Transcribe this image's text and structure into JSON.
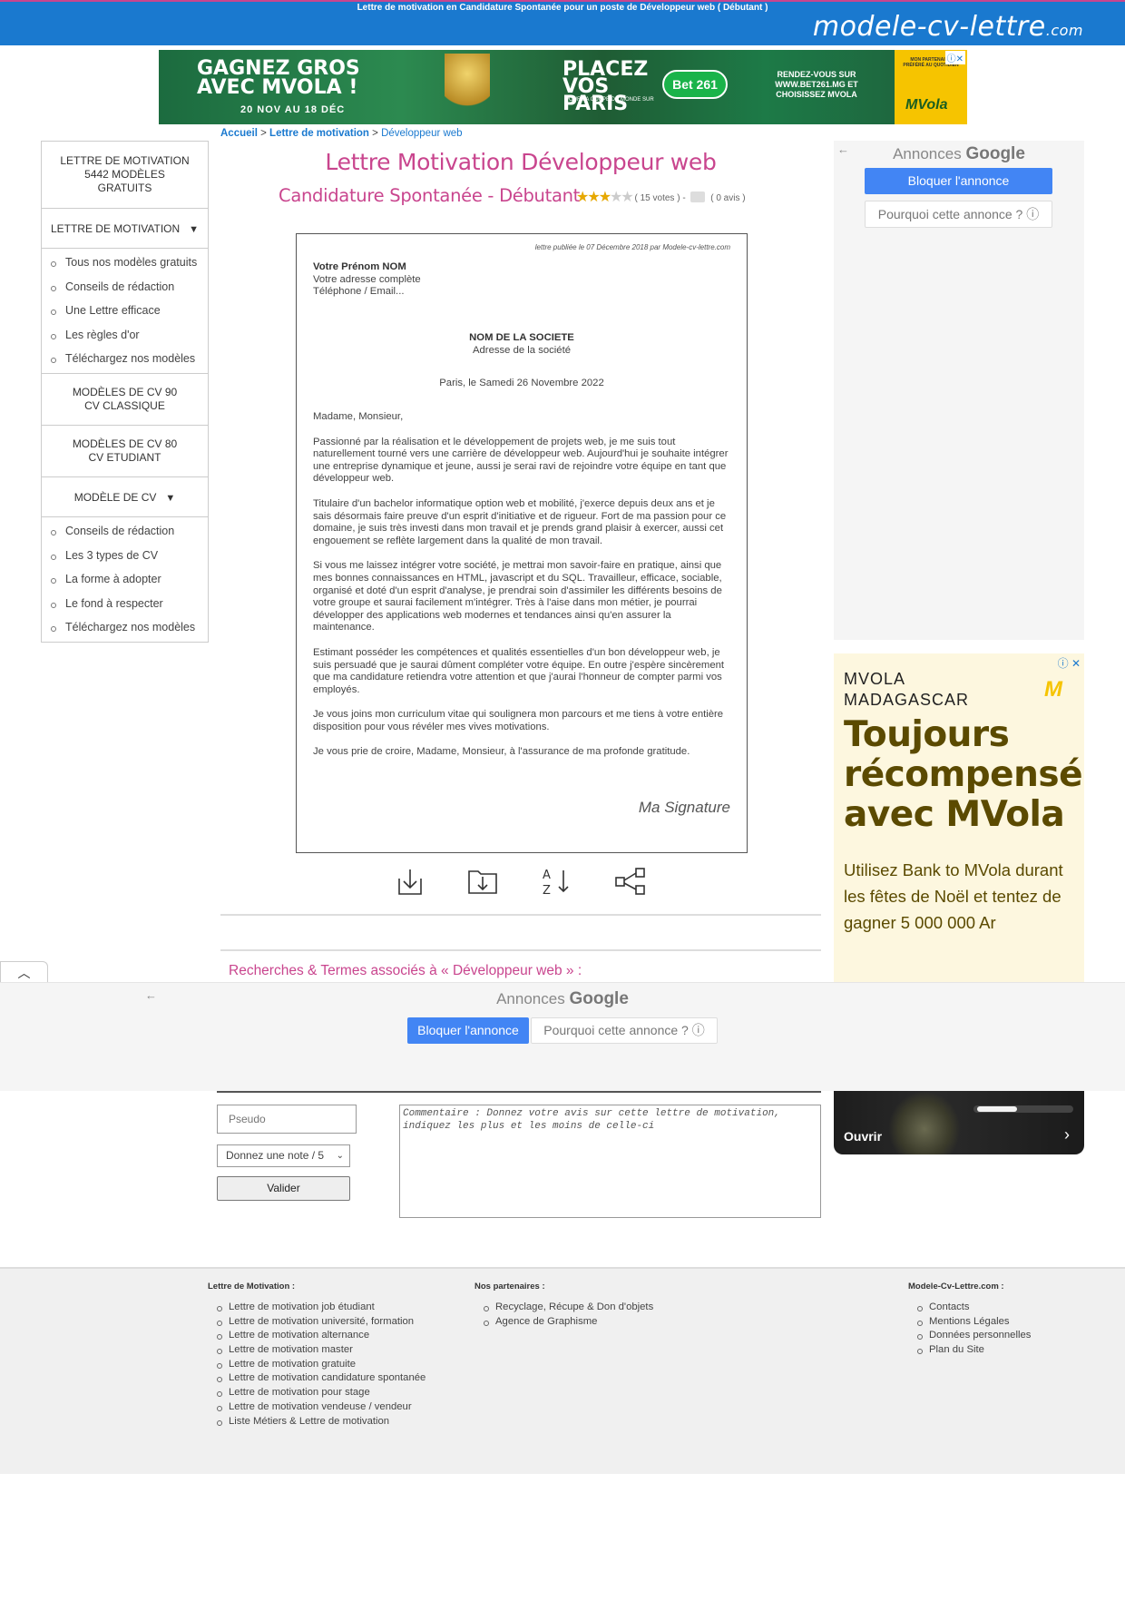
{
  "header": {
    "tagline": "Lettre de motivation en Candidature Spontanée pour un poste de Développeur web ( Débutant )",
    "logo_main": "modele-cv-lettre",
    "logo_tld": ".com",
    "brand_color": "#1a79cf",
    "accent_color": "#c9458e"
  },
  "banner_ad": {
    "headline": "GAGNEZ GROS AVEC MVOLA !",
    "dates": "20 NOV AU 18 DÉC",
    "place": "PLACEZ VOS PARIS",
    "place_sub": "POUR LA COUPE DU MONDE SUR",
    "bet_logo": "Bet 261",
    "cta": "RENDEZ-VOUS SUR WWW.BET261.MG ET CHOISISSEZ MVOLA",
    "partner": "MON PARTENAIRE PRÉFÉRÉ AU QUOTIDIEN",
    "mvola": "MVola"
  },
  "sidebar": {
    "block1": "LETTRE DE MOTIVATION 5442 MODÈLES GRATUITS",
    "section1": "LETTRE DE MOTIVATION",
    "section1_items": [
      "Tous nos modèles gratuits",
      "Conseils de rédaction",
      "Une Lettre efficace",
      "Les règles d'or",
      "Téléchargez nos modèles"
    ],
    "block2": "MODÈLES DE CV 90 CV CLASSIQUE",
    "block3": "MODÈLES DE CV 80 CV ETUDIANT",
    "section2": "MODÈLE DE CV",
    "section2_items": [
      "Conseils de rédaction",
      "Les 3 types de CV",
      "La forme à adopter",
      "Le fond à respecter",
      "Téléchargez nos modèles"
    ],
    "arrow": "▼"
  },
  "breadcrumb": {
    "home": "Accueil",
    "sep": ">",
    "section": "Lettre de motivation",
    "current": "Développeur web"
  },
  "page": {
    "title": "Lettre Motivation Développeur web",
    "subtitle": "Candidature Spontanée - Débutant",
    "rating_stars": 3,
    "votes": "( 15 votes )",
    "dash": "-",
    "avis": "( 0 avis )"
  },
  "letter": {
    "published": "lettre publiée le 07 Décembre 2018 par Modele-cv-lettre.com",
    "sender_name": "Votre Prénom NOM",
    "sender_address": "Votre adresse complète",
    "sender_contact": "Téléphone / Email...",
    "company_name": "NOM DE LA SOCIETE",
    "company_address": "Adresse de la société",
    "date": "Paris, le Samedi 26 Novembre 2022",
    "greeting": "Madame, Monsieur,",
    "paragraphs": [
      "Passionné par la réalisation et le développement de projets web, je me suis tout naturellement tourné vers une carrière de développeur web. Aujourd'hui je souhaite intégrer une entreprise dynamique et jeune, aussi je serai ravi de rejoindre votre équipe en tant que développeur web.",
      "Titulaire d'un bachelor informatique option web et mobilité, j'exerce depuis deux ans et je sais désormais faire preuve d'un esprit d'initiative et de rigueur. Fort de ma passion pour ce domaine, je suis très investi dans mon travail et je prends grand plaisir à exercer, aussi cet engouement se reflète largement dans la qualité de mon travail.",
      "Si vous me laissez intégrer votre société, je mettrai mon savoir-faire en pratique, ainsi que mes bonnes connaissances en HTML, javascript et du SQL. Travailleur, efficace, sociable, organisé et doté d'un esprit d'analyse, je prendrai soin d'assimiler les différents besoins de votre groupe et saurai facilement m'intégrer. Très à l'aise dans mon métier, je pourrai développer des applications web modernes et tendances ainsi qu'en assurer la maintenance.",
      "Estimant posséder les compétences et qualités essentielles d'un bon développeur web, je suis persuadé que je saurai dûment compléter votre équipe. En outre j'espère sincèrement que ma candidature retiendra votre attention et que j'aurai l'honneur de compter parmi vos employés.",
      "Je vous joins mon curriculum vitae qui soulignera mon parcours et me tiens à votre entière disposition pour vous révéler mes vives motivations.",
      "Je vous prie de croire, Madame, Monsieur, à l'assurance de ma profonde gratitude."
    ],
    "signature": "Ma Signature"
  },
  "actions": {
    "download": "download-icon",
    "print": "download-folder-icon",
    "sort": "sort-az-icon",
    "share": "share-icon"
  },
  "related": {
    "heading": "Recherches & Termes associés à « Développeur web » :"
  },
  "google_ads": {
    "annonces": "Annonces",
    "google": "Google",
    "block": "Bloquer l'annonce",
    "why": "Pourquoi cette annonce ? ⓘ",
    "back": "←"
  },
  "mvola_ad": {
    "adchoice": "ⓘ ✕",
    "brand": "MVOLA MADAGASCAR",
    "logo": "M",
    "headline": "Toujours récompensé avec MVola",
    "text": "Utilisez Bank to MVola durant les fêtes de Noël et tentez de gagner 5 000 000 Ar",
    "open": "Ouvrir"
  },
  "comment_form": {
    "pseudo_placeholder": "Pseudo",
    "note_selected": "Donnez une note / 5",
    "submit": "Valider",
    "comment_placeholder": "Commentaire : Donnez votre avis sur cette lettre de motivation, indiquez les plus et les moins de celle-ci"
  },
  "footer": {
    "col1_title": "Lettre de Motivation :",
    "col1_items": [
      "Lettre de motivation job étudiant",
      "Lettre de motivation université, formation",
      "Lettre de motivation alternance",
      "Lettre de motivation master",
      "Lettre de motivation gratuite",
      "Lettre de motivation candidature spontanée",
      "Lettre de motivation pour stage",
      "Lettre de motivation vendeuse / vendeur",
      "Liste Métiers & Lettre de motivation"
    ],
    "col2_title": "Nos partenaires :",
    "col2_items": [
      "Recyclage, Récupe & Don d'objets",
      "Agence de Graphisme"
    ],
    "col3_title": "Modele-Cv-Lettre.com :",
    "col3_items": [
      "Contacts",
      "Mentions Légales",
      "Données personnelles",
      "Plan du Site"
    ]
  }
}
